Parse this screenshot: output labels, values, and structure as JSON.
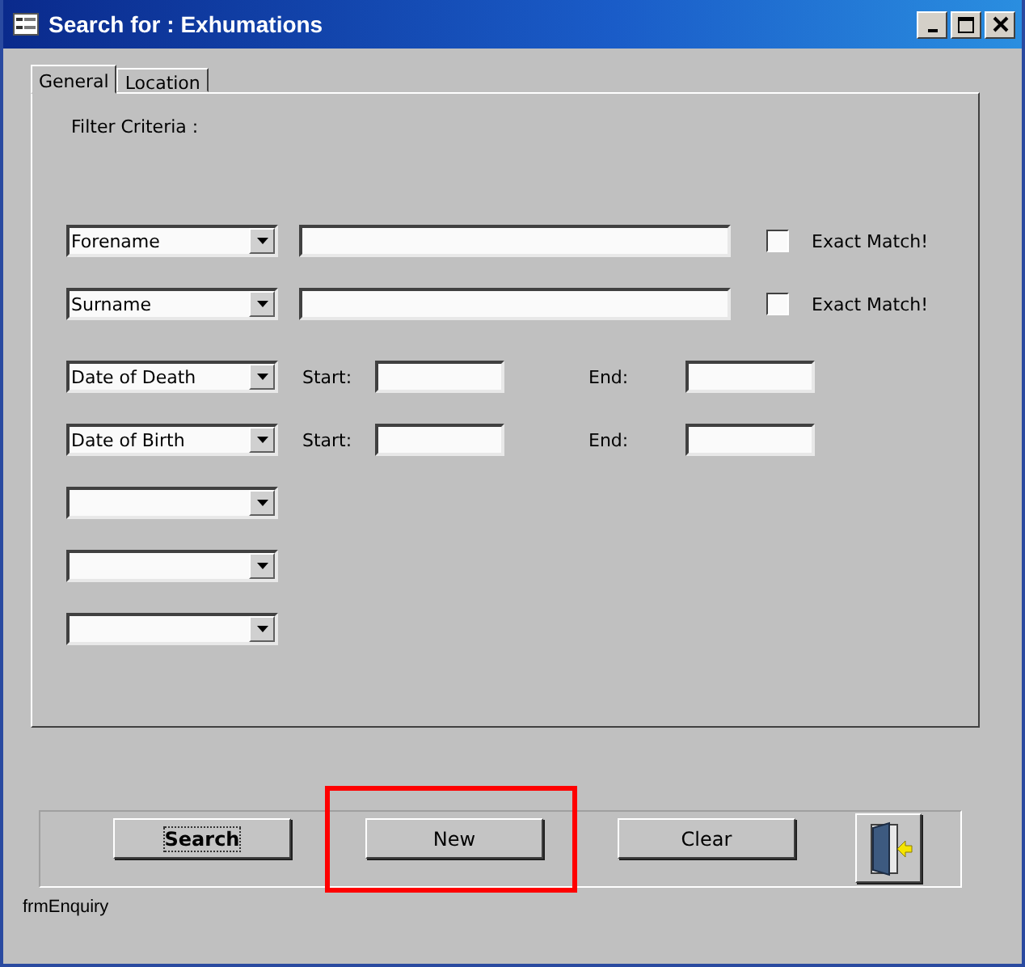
{
  "window": {
    "title": "Search for : Exhumations"
  },
  "tabs": [
    {
      "label": "General",
      "selected": true
    },
    {
      "label": "Location",
      "selected": false
    }
  ],
  "filter_label": "Filter Criteria :",
  "criteria": [
    {
      "kind": "text",
      "field": "Forename",
      "exact_match": false,
      "exact_match_label": "Exact Match!"
    },
    {
      "kind": "text",
      "field": "Surname",
      "exact_match": false,
      "exact_match_label": "Exact Match!"
    },
    {
      "kind": "range",
      "field": "Date of Death",
      "start_label": "Start:",
      "end_label": "End:"
    },
    {
      "kind": "range",
      "field": "Date of Birth",
      "start_label": "Start:",
      "end_label": "End:"
    },
    {
      "kind": "empty"
    },
    {
      "kind": "empty"
    },
    {
      "kind": "empty"
    }
  ],
  "buttons": [
    {
      "kind": "text",
      "label": "Search",
      "default": true,
      "highlighted": false
    },
    {
      "kind": "text",
      "label": "New",
      "default": false,
      "highlighted": true
    },
    {
      "kind": "text",
      "label": "Clear",
      "default": false,
      "highlighted": false
    },
    {
      "kind": "exit",
      "highlighted": false
    }
  ],
  "form_name": "frmEnquiry"
}
